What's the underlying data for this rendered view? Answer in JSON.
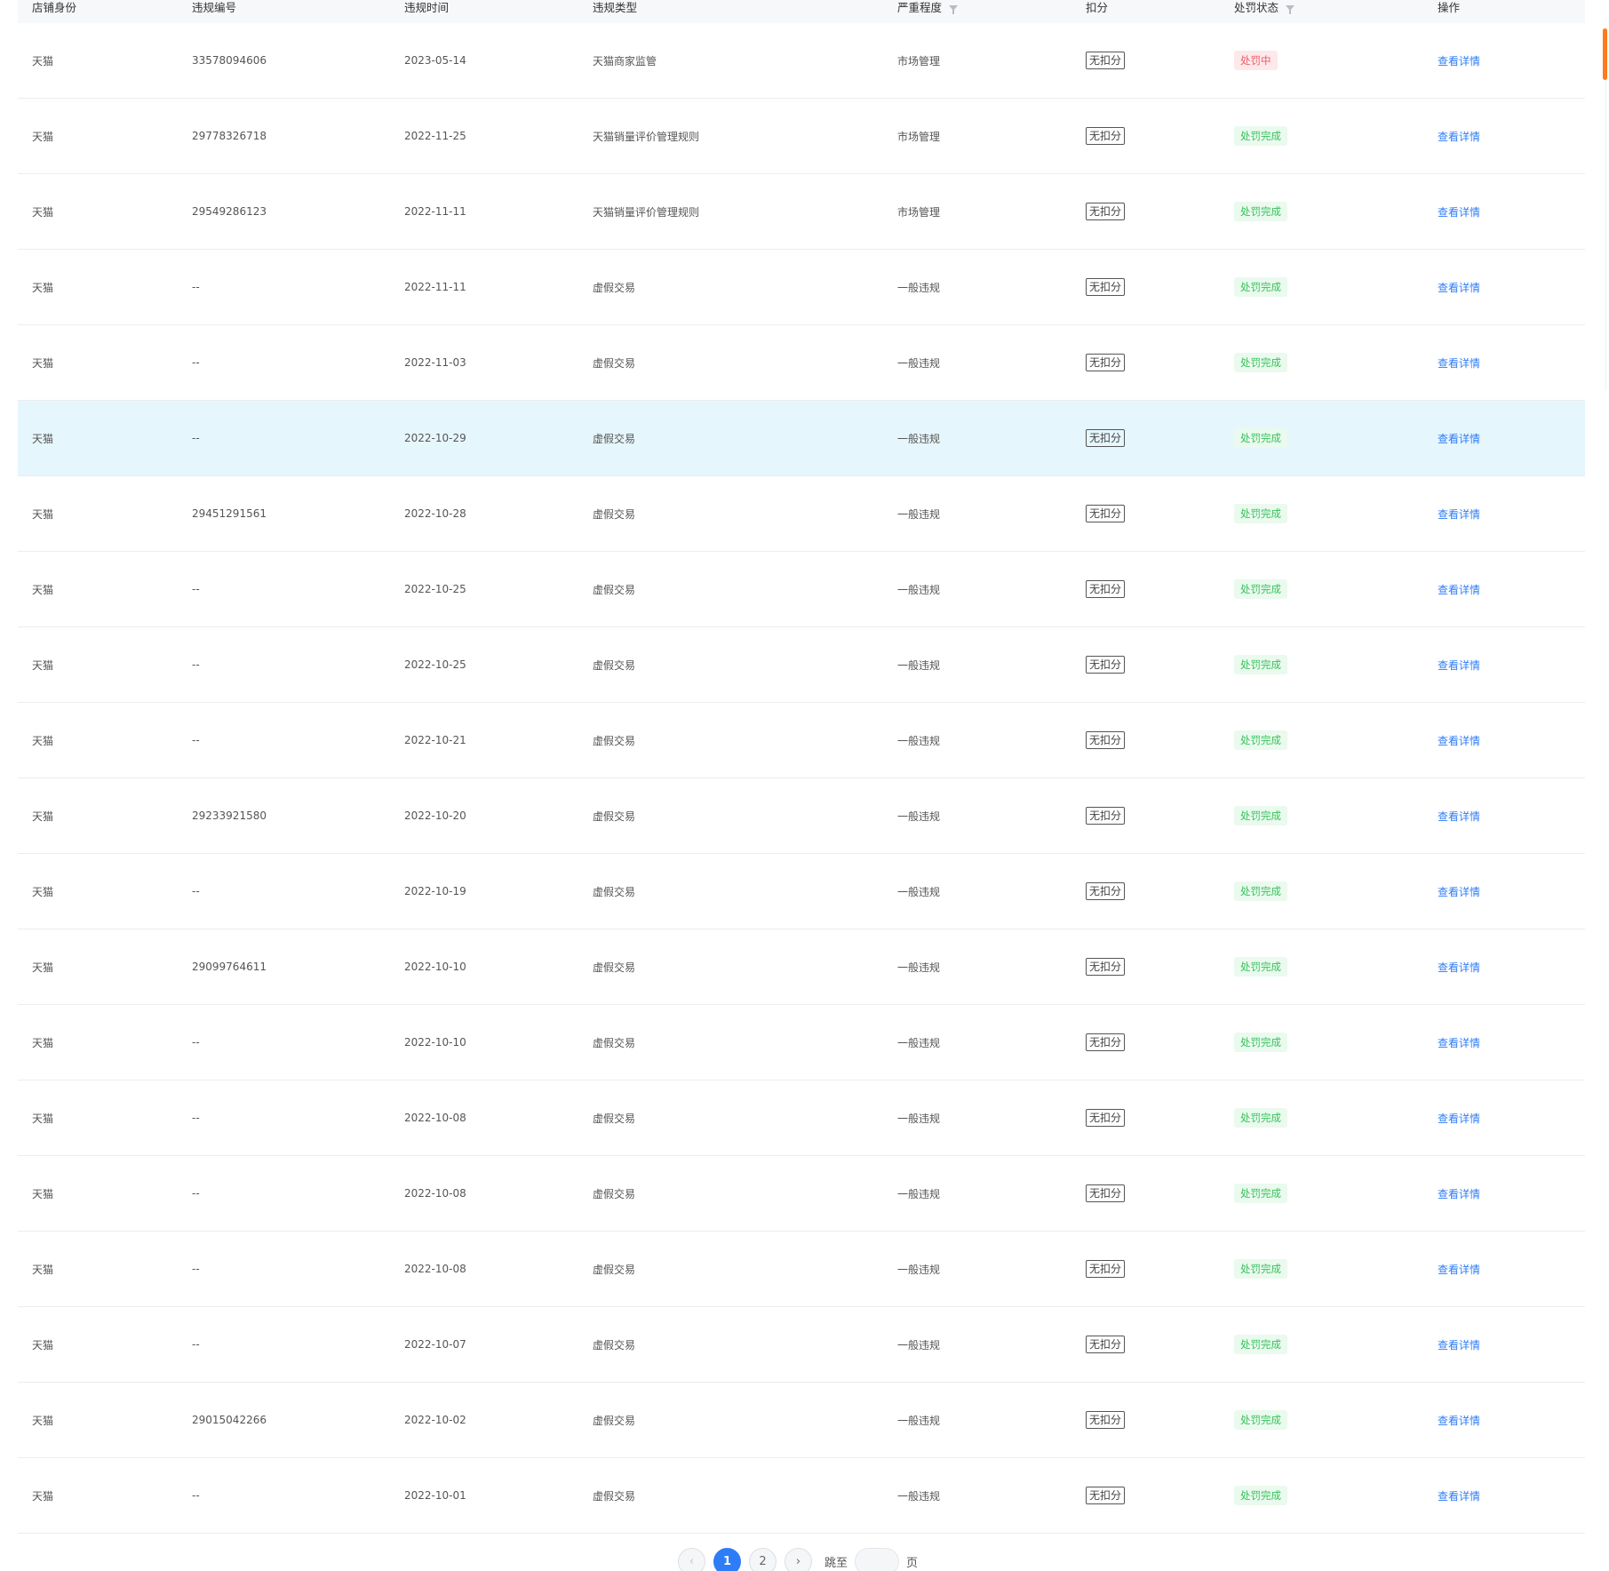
{
  "table": {
    "headers": [
      {
        "label": "店铺身份",
        "filter": false
      },
      {
        "label": "违规编号",
        "filter": false
      },
      {
        "label": "违规时间",
        "filter": false
      },
      {
        "label": "违规类型",
        "filter": false
      },
      {
        "label": "严重程度",
        "filter": true
      },
      {
        "label": "扣分",
        "filter": false
      },
      {
        "label": "处罚状态",
        "filter": true
      },
      {
        "label": "操作",
        "filter": false
      }
    ],
    "rows": [
      {
        "identity": "天猫",
        "id": "33578094606",
        "date": "2023-05-14",
        "type": "天猫商家监管",
        "severity": "市场管理",
        "points": "无扣分",
        "status": "处罚中",
        "status_kind": "processing",
        "action": "查看详情"
      },
      {
        "identity": "天猫",
        "id": "29778326718",
        "date": "2022-11-25",
        "type": "天猫销量评价管理规则",
        "severity": "市场管理",
        "points": "无扣分",
        "status": "处罚完成",
        "status_kind": "done",
        "action": "查看详情"
      },
      {
        "identity": "天猫",
        "id": "29549286123",
        "date": "2022-11-11",
        "type": "天猫销量评价管理规则",
        "severity": "市场管理",
        "points": "无扣分",
        "status": "处罚完成",
        "status_kind": "done",
        "action": "查看详情"
      },
      {
        "identity": "天猫",
        "id": "--",
        "date": "2022-11-11",
        "type": "虚假交易",
        "severity": "一般违规",
        "points": "无扣分",
        "status": "处罚完成",
        "status_kind": "done",
        "action": "查看详情"
      },
      {
        "identity": "天猫",
        "id": "--",
        "date": "2022-11-03",
        "type": "虚假交易",
        "severity": "一般违规",
        "points": "无扣分",
        "status": "处罚完成",
        "status_kind": "done",
        "action": "查看详情"
      },
      {
        "identity": "天猫",
        "id": "--",
        "date": "2022-10-29",
        "type": "虚假交易",
        "severity": "一般违规",
        "points": "无扣分",
        "status": "处罚完成",
        "status_kind": "done",
        "action": "查看详情",
        "highlight": true
      },
      {
        "identity": "天猫",
        "id": "29451291561",
        "date": "2022-10-28",
        "type": "虚假交易",
        "severity": "一般违规",
        "points": "无扣分",
        "status": "处罚完成",
        "status_kind": "done",
        "action": "查看详情"
      },
      {
        "identity": "天猫",
        "id": "--",
        "date": "2022-10-25",
        "type": "虚假交易",
        "severity": "一般违规",
        "points": "无扣分",
        "status": "处罚完成",
        "status_kind": "done",
        "action": "查看详情"
      },
      {
        "identity": "天猫",
        "id": "--",
        "date": "2022-10-25",
        "type": "虚假交易",
        "severity": "一般违规",
        "points": "无扣分",
        "status": "处罚完成",
        "status_kind": "done",
        "action": "查看详情"
      },
      {
        "identity": "天猫",
        "id": "--",
        "date": "2022-10-21",
        "type": "虚假交易",
        "severity": "一般违规",
        "points": "无扣分",
        "status": "处罚完成",
        "status_kind": "done",
        "action": "查看详情"
      },
      {
        "identity": "天猫",
        "id": "29233921580",
        "date": "2022-10-20",
        "type": "虚假交易",
        "severity": "一般违规",
        "points": "无扣分",
        "status": "处罚完成",
        "status_kind": "done",
        "action": "查看详情"
      },
      {
        "identity": "天猫",
        "id": "--",
        "date": "2022-10-19",
        "type": "虚假交易",
        "severity": "一般违规",
        "points": "无扣分",
        "status": "处罚完成",
        "status_kind": "done",
        "action": "查看详情"
      },
      {
        "identity": "天猫",
        "id": "29099764611",
        "date": "2022-10-10",
        "type": "虚假交易",
        "severity": "一般违规",
        "points": "无扣分",
        "status": "处罚完成",
        "status_kind": "done",
        "action": "查看详情"
      },
      {
        "identity": "天猫",
        "id": "--",
        "date": "2022-10-10",
        "type": "虚假交易",
        "severity": "一般违规",
        "points": "无扣分",
        "status": "处罚完成",
        "status_kind": "done",
        "action": "查看详情"
      },
      {
        "identity": "天猫",
        "id": "--",
        "date": "2022-10-08",
        "type": "虚假交易",
        "severity": "一般违规",
        "points": "无扣分",
        "status": "处罚完成",
        "status_kind": "done",
        "action": "查看详情"
      },
      {
        "identity": "天猫",
        "id": "--",
        "date": "2022-10-08",
        "type": "虚假交易",
        "severity": "一般违规",
        "points": "无扣分",
        "status": "处罚完成",
        "status_kind": "done",
        "action": "查看详情"
      },
      {
        "identity": "天猫",
        "id": "--",
        "date": "2022-10-08",
        "type": "虚假交易",
        "severity": "一般违规",
        "points": "无扣分",
        "status": "处罚完成",
        "status_kind": "done",
        "action": "查看详情"
      },
      {
        "identity": "天猫",
        "id": "--",
        "date": "2022-10-07",
        "type": "虚假交易",
        "severity": "一般违规",
        "points": "无扣分",
        "status": "处罚完成",
        "status_kind": "done",
        "action": "查看详情"
      },
      {
        "identity": "天猫",
        "id": "29015042266",
        "date": "2022-10-02",
        "type": "虚假交易",
        "severity": "一般违规",
        "points": "无扣分",
        "status": "处罚完成",
        "status_kind": "done",
        "action": "查看详情"
      },
      {
        "identity": "天猫",
        "id": "--",
        "date": "2022-10-01",
        "type": "虚假交易",
        "severity": "一般违规",
        "points": "无扣分",
        "status": "处罚完成",
        "status_kind": "done",
        "action": "查看详情"
      }
    ]
  },
  "pagination": {
    "prev_icon": "chevron-left-icon",
    "next_icon": "chevron-right-icon",
    "pages": [
      "1",
      "2"
    ],
    "current_page": "1",
    "jump_label": "跳至",
    "jump_value": "",
    "page_unit": "页"
  },
  "colors": {
    "link": "#2f7df6",
    "status_done_text": "#37c25b",
    "status_done_bg": "#eafaee",
    "status_processing_text": "#f25c68",
    "status_processing_bg": "#fde8ea",
    "row_highlight": "#e6f6fd",
    "scroll_thumb": "#ff7a1a"
  }
}
